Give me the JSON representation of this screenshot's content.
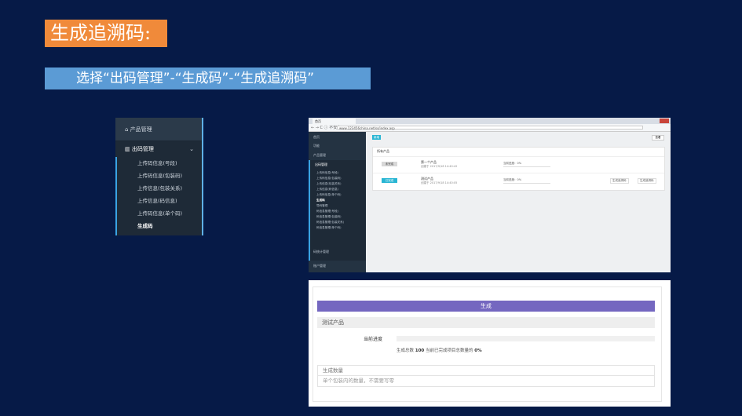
{
  "slide": {
    "title": "生成追溯码:",
    "instruction": "选择“出码管理”-“生成码”-“生成追溯码”"
  },
  "sidebar_crop": {
    "category1": "产品管理",
    "category2": "出码管理",
    "items": [
      {
        "label": "上传码信息(号段)"
      },
      {
        "label": "上传码信息(包装码)"
      },
      {
        "label": "上传信息(包装关系)"
      },
      {
        "label": "上传信息(码信息)"
      },
      {
        "label": "上传码信息(单个码)"
      },
      {
        "label": "生成码",
        "active": true
      }
    ]
  },
  "browser": {
    "tab_title": "首页",
    "address": "www.123456china.net/ss/index.asp",
    "nav": "← → C ⓘ 不安全",
    "sidebar": {
      "top1": "首页",
      "top2": "功能",
      "product": "产品管理",
      "outcode": "出码管理",
      "items": [
        "上传码信息(号段)",
        "上传码信息(包装码)",
        "上传信息(包装关系)",
        "上传信息(码信息)",
        "上传码信息(单个码)",
        "生成码",
        "导码管理",
        "码信息管理(号段)",
        "码信息管理(包装码)",
        "码信息管理(包装关系)",
        "码信息管理(单个码)"
      ],
      "active_index": 5,
      "statistics": "码统计管理",
      "account": "账户管理"
    },
    "main": {
      "top_button": "新增",
      "right_button": "查看",
      "panel_title": "所有产品",
      "products": [
        {
          "status": "未完成",
          "status_color": "#d8d8d8",
          "name": "第一个产品",
          "date": "创建于 2017/9/18 14:40:42",
          "progress": "当前进度：0%"
        },
        {
          "status": "已完成",
          "status_color": "#28b5d3",
          "name": "测试产品",
          "date": "创建于 2017/9/18 14:40:05",
          "progress": "当前进度：0%",
          "actions": [
            "生成追溯码",
            "生成追溯码"
          ]
        }
      ]
    }
  },
  "dialog": {
    "header": "生成",
    "product_name": "测试产品",
    "progress_label": "当前进度",
    "summary_prefix": "生成总数",
    "summary_total": "100",
    "summary_mid": "当前已完成项目总数量的",
    "summary_percent": "0%",
    "quantity_label": "生成数量",
    "quantity_placeholder": "单个包装内的数量，不需要写零"
  }
}
